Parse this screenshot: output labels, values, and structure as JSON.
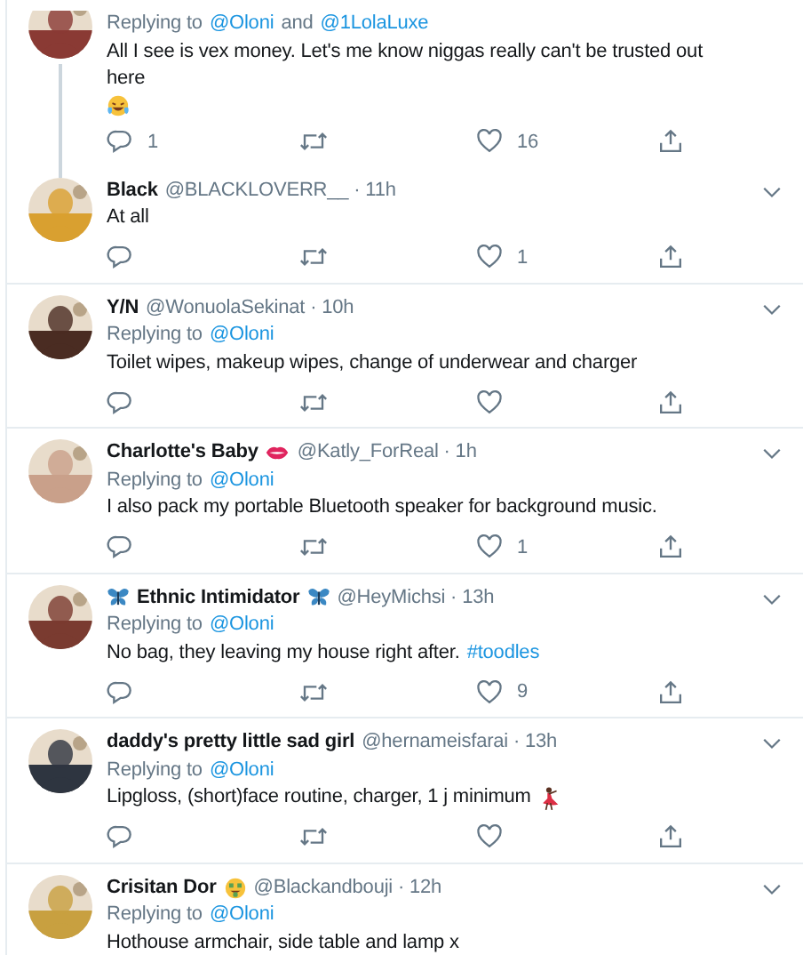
{
  "tweets": [
    {
      "thread_below": true,
      "replying": [
        {
          "kind": "plain",
          "text": "Replying to"
        },
        {
          "kind": "mention",
          "text": "@Oloni"
        },
        {
          "kind": "plain",
          "text": "and"
        },
        {
          "kind": "mention",
          "text": "@1LolaLuxe"
        }
      ],
      "body": [
        {
          "kind": "plain",
          "text": "All I see is vex money. Let's me know niggas really can't be trusted out here"
        },
        {
          "kind": "laughing"
        }
      ],
      "actions": {
        "replies": "1",
        "likes": "16"
      }
    },
    {
      "header": {
        "parts": [
          {
            "kind": "name",
            "text": "Black"
          }
        ],
        "handle": "@BLACKLOVERR__ · 11h"
      },
      "thread_below": false,
      "body": [
        {
          "kind": "plain",
          "text": "At all"
        }
      ],
      "actions": {
        "likes": "1"
      }
    },
    {
      "header": {
        "parts": [
          {
            "kind": "name",
            "text": "Y/N"
          }
        ],
        "handle": "@WonuolaSekinat · 10h"
      },
      "thread_below": false,
      "replying": [
        {
          "kind": "plain",
          "text": "Replying to"
        },
        {
          "kind": "mention",
          "text": "@Oloni"
        }
      ],
      "body": [
        {
          "kind": "plain",
          "text": "Toilet wipes, makeup wipes, change of underwear and charger"
        }
      ]
    },
    {
      "header": {
        "parts": [
          {
            "kind": "name",
            "text": "Charlotte's Baby"
          },
          {
            "kind": "lips"
          }
        ],
        "handle": "@Katly_ForReal · 1h"
      },
      "thread_below": false,
      "replying": [
        {
          "kind": "plain",
          "text": "Replying to"
        },
        {
          "kind": "mention",
          "text": "@Oloni"
        }
      ],
      "body": [
        {
          "kind": "plain",
          "text": "I also pack my portable Bluetooth speaker for background music."
        }
      ],
      "actions": {
        "likes": "1"
      }
    },
    {
      "header": {
        "parts": [
          {
            "kind": "butterfly"
          },
          {
            "kind": "name",
            "text": "Ethnic Intimidator"
          },
          {
            "kind": "butterfly"
          }
        ],
        "handle": "@HeyMichsi · 13h"
      },
      "thread_below": false,
      "replying": [
        {
          "kind": "plain",
          "text": "Replying to"
        },
        {
          "kind": "mention",
          "text": "@Oloni"
        }
      ],
      "body": [
        {
          "kind": "plain",
          "text": "No bag, they leaving my house right after."
        },
        {
          "kind": "hashtag",
          "text": "#toodles"
        }
      ],
      "actions": {
        "likes": "9"
      }
    },
    {
      "header": {
        "parts": [
          {
            "kind": "name",
            "text": "daddy's pretty little sad girl"
          }
        ],
        "handle": "@hernameisfarai · 13h"
      },
      "thread_below": false,
      "replying": [
        {
          "kind": "plain",
          "text": "Replying to"
        },
        {
          "kind": "mention",
          "text": "@Oloni"
        }
      ],
      "body": [
        {
          "kind": "plain",
          "text": "Lipgloss, (short)face routine, charger, 1 j minimum"
        },
        {
          "kind": "dancer"
        }
      ]
    },
    {
      "header": {
        "parts": [
          {
            "kind": "name",
            "text": "Crisitan Dor"
          },
          {
            "kind": "moneyface"
          }
        ],
        "handle": "@Blackandbouji · 12h"
      },
      "thread_below": false,
      "replying": [
        {
          "kind": "plain",
          "text": "Replying to"
        },
        {
          "kind": "mention",
          "text": "@Oloni"
        }
      ],
      "body": [
        {
          "kind": "plain",
          "text": "Hothouse armchair, side table and lamp x"
        }
      ]
    }
  ]
}
